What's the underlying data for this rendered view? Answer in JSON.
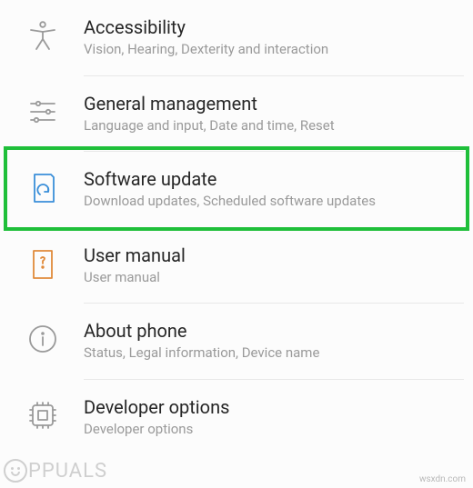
{
  "items": [
    {
      "id": "accessibility",
      "title": "Accessibility",
      "subtitle": "Vision, Hearing, Dexterity and interaction",
      "icon": "accessibility-icon",
      "icon_color": "#9a9a9a",
      "highlighted": false
    },
    {
      "id": "general-management",
      "title": "General management",
      "subtitle": "Language and input, Date and time, Reset",
      "icon": "sliders-icon",
      "icon_color": "#9a9a9a",
      "highlighted": false
    },
    {
      "id": "software-update",
      "title": "Software update",
      "subtitle": "Download updates, Scheduled software updates",
      "icon": "software-update-icon",
      "icon_color": "#3a8fd9",
      "highlighted": true
    },
    {
      "id": "user-manual",
      "title": "User manual",
      "subtitle": "User manual",
      "icon": "user-manual-icon",
      "icon_color": "#e08a3a",
      "highlighted": false
    },
    {
      "id": "about-phone",
      "title": "About phone",
      "subtitle": "Status, Legal information, Device name",
      "icon": "info-icon",
      "icon_color": "#9a9a9a",
      "highlighted": false
    },
    {
      "id": "developer-options",
      "title": "Developer options",
      "subtitle": "Developer options",
      "icon": "developer-icon",
      "icon_color": "#9a9a9a",
      "highlighted": false
    }
  ],
  "highlight_color": "#1fbf3a",
  "watermark": "PPUALS",
  "credit": "wsxdn.com"
}
